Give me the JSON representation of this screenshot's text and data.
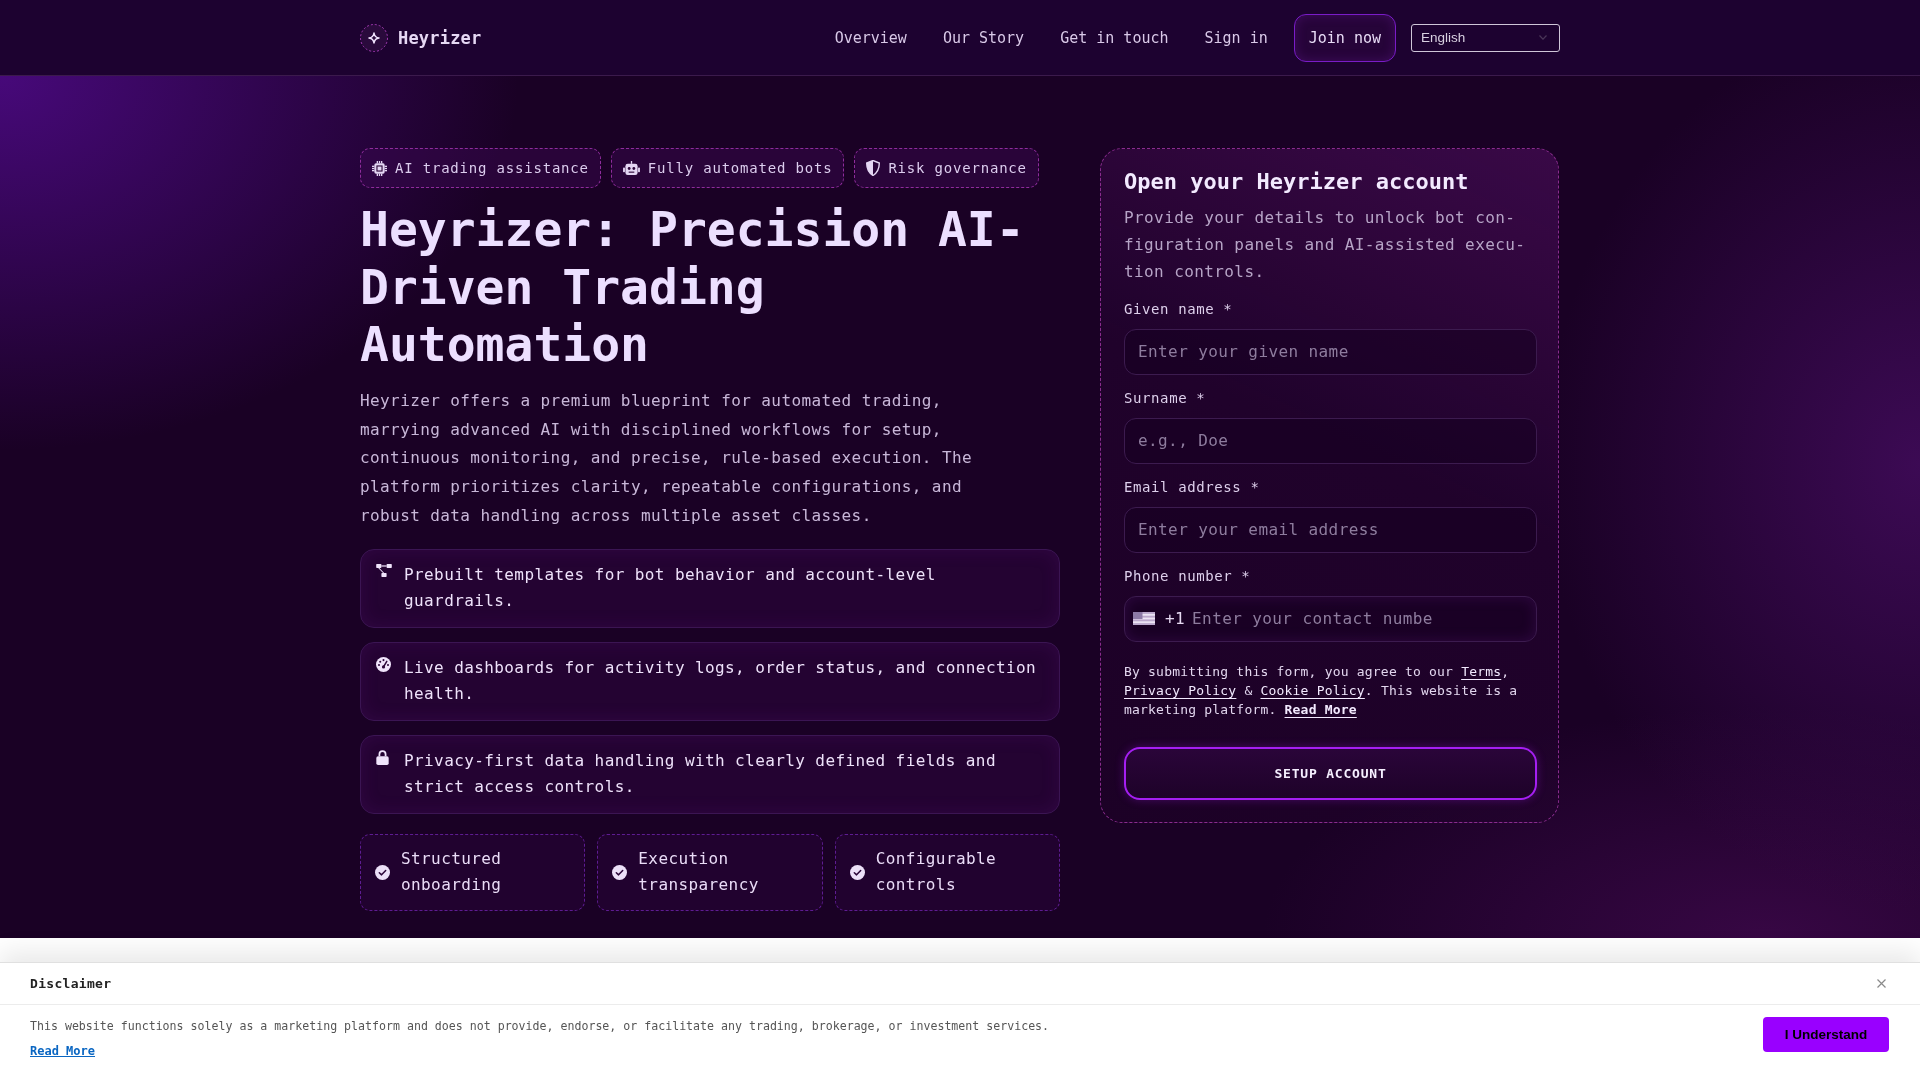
{
  "header": {
    "brand": "Heyrizer",
    "nav": [
      {
        "label": "Overview"
      },
      {
        "label": "Our Story"
      },
      {
        "label": "Get in touch"
      },
      {
        "label": "Sign in"
      }
    ],
    "join_button": "Join now",
    "language_select": {
      "value": "English"
    }
  },
  "hero": {
    "badges": [
      {
        "label": "AI trading assistance"
      },
      {
        "label": "Fully automated bots"
      },
      {
        "label": "Risk governance"
      }
    ],
    "title": "Heyrizer: Precision AI-Driven Trading Automation",
    "description": "Heyrizer offers a premium blueprint for automated trading, marrying advanced AI with disciplined workflows for setup, continuous monitoring, and precise, rule-based execution. The platform prioritizes clarity, repeatable configurations, and robust data handling across multiple asset classes.",
    "features": [
      {
        "text": "Prebuilt templates for bot behavior and account-level guardrails."
      },
      {
        "text": "Live dashboards for activity logs, order status, and connection health."
      },
      {
        "text": "Privacy-first data handling with clearly defined fields and strict access controls."
      }
    ],
    "highlights": [
      {
        "label": "Structured onboarding"
      },
      {
        "label": "Execution transparency"
      },
      {
        "label": "Configurable controls"
      }
    ]
  },
  "signup_form": {
    "title": "Open your Heyrizer account",
    "description": "Provide your details to unlock bot con-figuration panels and AI-assisted execu-tion controls.",
    "fields": [
      {
        "kind": "text",
        "label": "Given name *",
        "placeholder": "Enter your given name"
      },
      {
        "kind": "text",
        "label": "Surname *",
        "placeholder": "e.g., Doe"
      },
      {
        "kind": "text",
        "label": "Email address *",
        "placeholder": "Enter your email address"
      },
      {
        "kind": "phone",
        "label": "Phone number *",
        "prefix": "+1",
        "placeholder": "Enter your contact numbe"
      }
    ],
    "consent": [
      {
        "kind": "text",
        "text": "By submitting this form, you agree to our "
      },
      {
        "kind": "link",
        "text": "Terms"
      },
      {
        "kind": "text",
        "text": ", "
      },
      {
        "kind": "link",
        "text": "Privacy Policy"
      },
      {
        "kind": "text",
        "text": " & "
      },
      {
        "kind": "link",
        "text": "Cookie Policy"
      },
      {
        "kind": "text",
        "text": ". This website is a marketing platform. "
      },
      {
        "kind": "bold_link",
        "text": "Read More"
      }
    ],
    "submit_button": "SETUP ACCOUNT"
  },
  "disclaimer": {
    "title": "Disclaimer",
    "text": "This website functions solely as a marketing platform and does not provide, endorse, or facilitate any trading, brokerage, or investment services.",
    "link": "Read More",
    "button": "I Understand"
  }
}
